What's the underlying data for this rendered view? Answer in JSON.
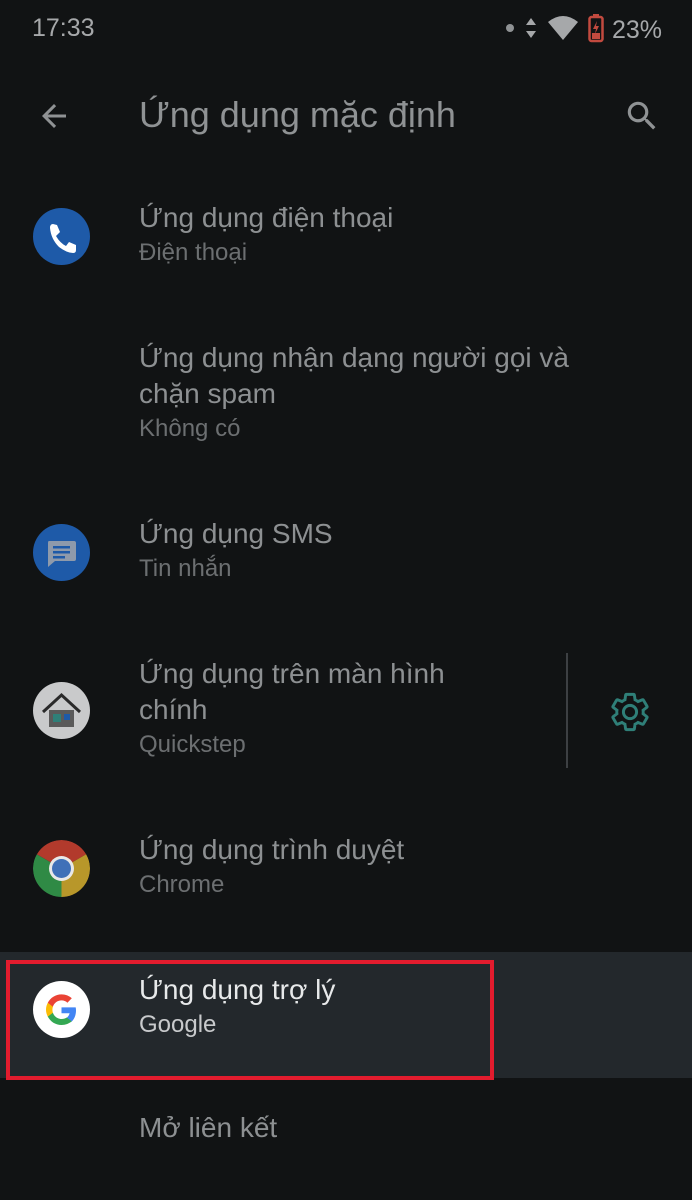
{
  "status_bar": {
    "time": "17:33",
    "battery_percent": "23%"
  },
  "app_bar": {
    "title": "Ứng dụng mặc định"
  },
  "items": [
    {
      "title": "Ứng dụng điện thoại",
      "subtitle": "Điện thoại",
      "icon": "phone-icon"
    },
    {
      "title_line1": "Ứng dụng nhận dạng người gọi và",
      "title_line2": "chặn spam",
      "subtitle": "Không có"
    },
    {
      "title": "Ứng dụng SMS",
      "subtitle": "Tin nhắn",
      "icon": "messages-icon"
    },
    {
      "title_line1": "Ứng dụng trên màn hình",
      "title_line2": "chính",
      "subtitle": "Quickstep",
      "icon": "home-launcher-icon"
    },
    {
      "title": "Ứng dụng trình duyệt",
      "subtitle": "Chrome",
      "icon": "chrome-icon"
    },
    {
      "title": "Ứng dụng trợ lý",
      "subtitle": "Google",
      "icon": "google-icon",
      "highlighted": true
    },
    {
      "title": "Mở liên kết"
    }
  ],
  "colors": {
    "background": "#111314",
    "highlight_background": "#23282c",
    "highlight_frame": "#e21c2e",
    "accent_teal": "#2f7f78",
    "phone_blue": "#1e5aa8"
  }
}
